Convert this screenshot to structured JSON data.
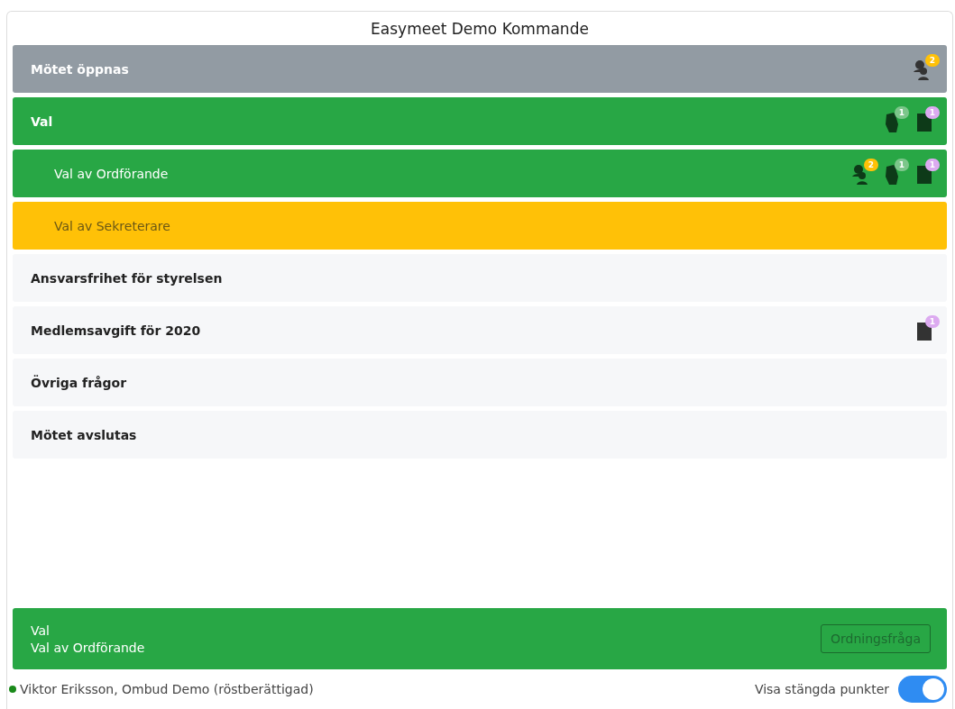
{
  "title": "Easymeet Demo Kommande",
  "agenda": [
    {
      "label": "Mötet öppnas",
      "kind": "closed",
      "badges": [
        {
          "kind": "speakers",
          "count": "2"
        }
      ]
    },
    {
      "label": "Val",
      "kind": "active",
      "badges": [
        {
          "kind": "votes",
          "count": "1"
        },
        {
          "kind": "documents",
          "count": "1"
        }
      ],
      "children": [
        {
          "label": "Val av Ordförande",
          "kind": "active",
          "badges": [
            {
              "kind": "speakers",
              "count": "2"
            },
            {
              "kind": "votes",
              "count": "1"
            },
            {
              "kind": "documents",
              "count": "1"
            }
          ]
        },
        {
          "label": "Val av Sekreterare",
          "kind": "next"
        }
      ]
    },
    {
      "label": "Ansvarsfrihet för styrelsen",
      "kind": "pending"
    },
    {
      "label": "Medlemsavgift för 2020",
      "kind": "pending",
      "badges": [
        {
          "kind": "documents",
          "count": "1"
        }
      ]
    },
    {
      "label": "Övriga frågor",
      "kind": "pending"
    },
    {
      "label": "Mötet avslutas",
      "kind": "pending"
    }
  ],
  "current": {
    "lines": [
      "Val",
      "Val av Ordförande"
    ],
    "button": "Ordningsfråga"
  },
  "user": {
    "text": "Viktor Eriksson, Ombud Demo (röstberättigad)",
    "online": true
  },
  "toggle": {
    "label": "Visa stängda punkter",
    "on": true
  }
}
